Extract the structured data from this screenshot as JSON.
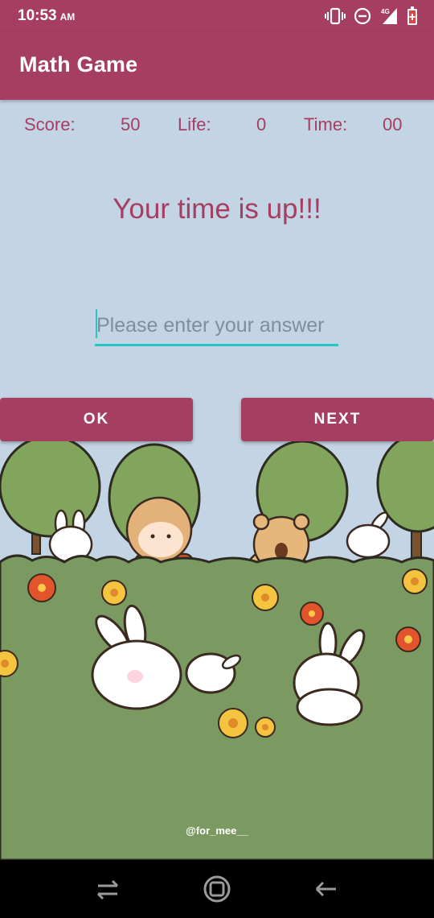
{
  "status_bar": {
    "time": "10:53",
    "ampm": "AM",
    "network_label": "4G",
    "icons": [
      "vibrate-icon",
      "do-not-disturb-icon",
      "signal-icon",
      "battery-icon"
    ]
  },
  "app_bar": {
    "title": "Math Game"
  },
  "stats": {
    "score_label": "Score:",
    "score_value": "50",
    "life_label": "Life:",
    "life_value": "0",
    "time_label": "Time:",
    "time_value": "00"
  },
  "message": "Your time is up!!!",
  "answer_input": {
    "value": "",
    "placeholder": "Please enter your answer"
  },
  "buttons": {
    "ok": "OK",
    "next": "NEXT"
  },
  "illustration": {
    "credit": "@for_mee__"
  },
  "nav_bar": {
    "icons": [
      "recents-icon",
      "home-icon",
      "back-icon"
    ]
  },
  "colors": {
    "primary": "#a63e62",
    "background": "#c3d4e4",
    "accent": "#26c6c3",
    "grass": "#7b9a62"
  }
}
